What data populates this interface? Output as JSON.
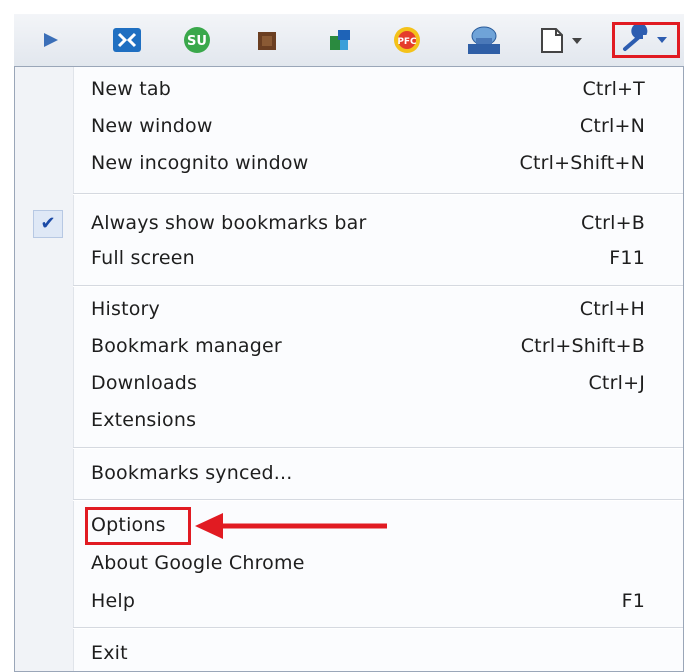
{
  "toolbar": {
    "icons": [
      "play-icon",
      "window-switch-icon",
      "stumble-icon",
      "brown-box-icon",
      "puzzle-icon",
      "pfc-icon",
      "network-monitor-icon",
      "page-menu-icon",
      "wrench-menu-icon"
    ]
  },
  "colors": {
    "highlight": "#e11b22",
    "check": "#1c4aa6"
  },
  "menu": {
    "new_tab": {
      "label": "New tab",
      "shortcut": "Ctrl+T"
    },
    "new_window": {
      "label": "New window",
      "shortcut": "Ctrl+N"
    },
    "new_incognito": {
      "label": "New incognito window",
      "shortcut": "Ctrl+Shift+N"
    },
    "always_show_bookmarks": {
      "label": "Always show bookmarks bar",
      "shortcut": "Ctrl+B",
      "checked": true
    },
    "full_screen": {
      "label": "Full screen",
      "shortcut": "F11"
    },
    "history": {
      "label": "History",
      "shortcut": "Ctrl+H"
    },
    "bookmark_manager": {
      "label": "Bookmark manager",
      "shortcut": "Ctrl+Shift+B"
    },
    "downloads": {
      "label": "Downloads",
      "shortcut": "Ctrl+J"
    },
    "extensions": {
      "label": "Extensions"
    },
    "bookmarks_synced": {
      "label": "Bookmarks synced..."
    },
    "options": {
      "label": "Options"
    },
    "about": {
      "label": "About Google Chrome"
    },
    "help": {
      "label": "Help",
      "shortcut": "F1"
    },
    "exit": {
      "label": "Exit"
    }
  }
}
